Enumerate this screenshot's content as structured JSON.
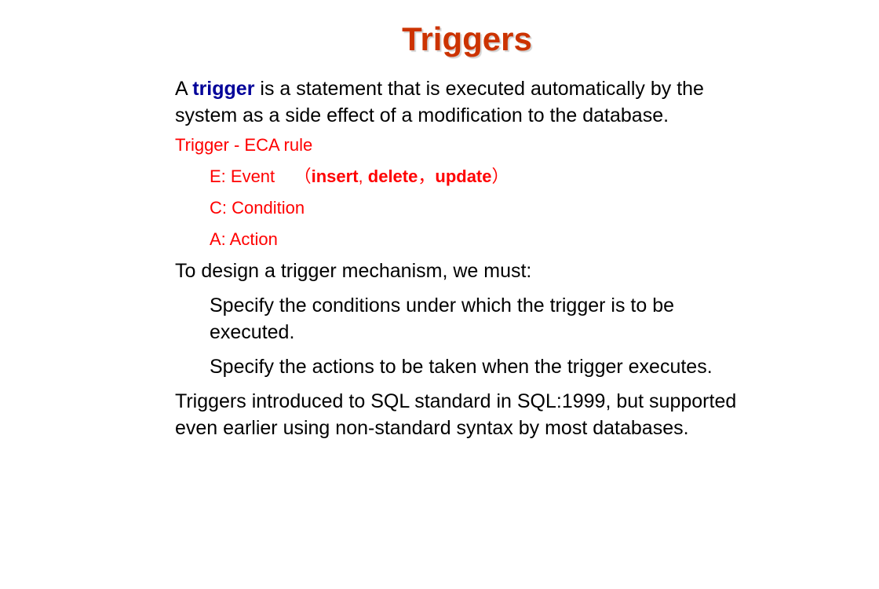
{
  "title": "Triggers",
  "intro": {
    "prefix": "A ",
    "keyword": "trigger",
    "rest": " is a statement that is executed automatically by the system as a side effect of a modification to the database."
  },
  "eca": {
    "heading": "Trigger -  ECA rule",
    "event": {
      "label": "E: Event    （",
      "insert": "insert",
      "sep1": ", ",
      "delete": "delete",
      "sep2": "，",
      "update": "update",
      "close": "）"
    },
    "condition": "C: Condition",
    "action": "A: Action"
  },
  "design": {
    "heading": "To design a trigger mechanism, we must:",
    "items": [
      "Specify the conditions under which the trigger is to be executed.",
      "Specify the actions to be taken when the trigger executes."
    ]
  },
  "history": "Triggers introduced to SQL standard in SQL:1999, but supported even earlier using non-standard syntax by most databases."
}
